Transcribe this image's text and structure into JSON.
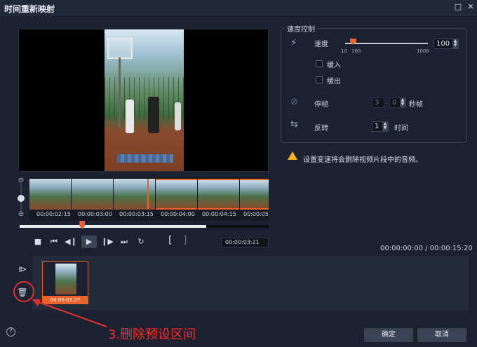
{
  "window": {
    "title": "时间重新映射",
    "maximize_glyph": "□",
    "close_glyph": "✕"
  },
  "filmstrip": {
    "timecodes": [
      "00:00:02:15",
      "00:00:03:00",
      "00:00:03:15",
      "00:00:04:00",
      "00:00:04:15",
      "00:00:05:"
    ]
  },
  "playback": {
    "bracket_in": "[",
    "bracket_out": "]",
    "current_time": "00:00:03:21",
    "scrub_progress": 0.75,
    "marker_fraction": 0.24
  },
  "speed_panel": {
    "title": "速度控制",
    "speed_label": "速度",
    "speed_value": "100",
    "slider_min_label": "10",
    "slider_mid_label": "100",
    "slider_max_label": "1000",
    "ease_in_label": "缓入",
    "ease_out_label": "缓出",
    "freeze_label": "停帧",
    "freeze_seconds": "3",
    "freeze_frames": "0",
    "freeze_unit": "秒帧",
    "reverse_label": "反转",
    "reverse_value": "1",
    "reverse_unit": "时间"
  },
  "warning": {
    "text": "设置变速将会删除视频片段中的音频。"
  },
  "time_total": "00:00:00:00 / 00:00:15:20",
  "track": {
    "clip_label": "00:00:03:27"
  },
  "annotation": {
    "text": "3.删除预设区间",
    "color": "#ff2a2a"
  },
  "buttons": {
    "help": "?",
    "ok": "确定",
    "cancel": "取消"
  },
  "colors": {
    "accent": "#e8622c",
    "background": "#1b2130",
    "warning": "#f2b21d"
  }
}
